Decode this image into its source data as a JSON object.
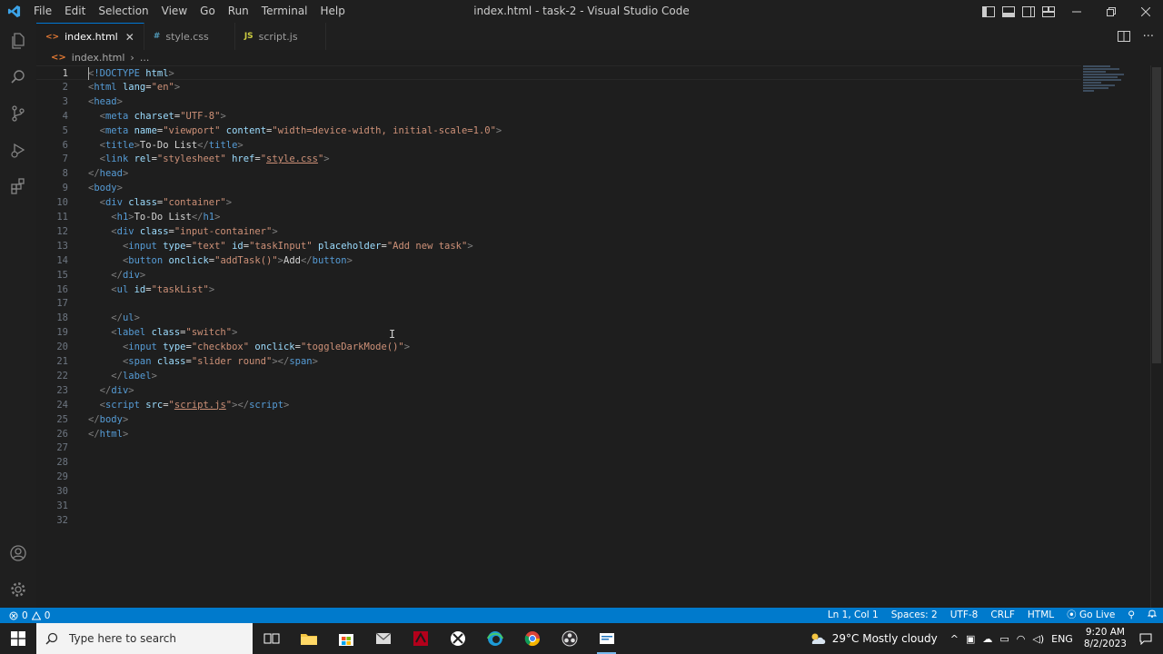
{
  "window": {
    "title": "index.html - task-2 - Visual Studio Code",
    "menu": [
      "File",
      "Edit",
      "Selection",
      "View",
      "Go",
      "Run",
      "Terminal",
      "Help"
    ]
  },
  "tabs": [
    {
      "label": "index.html",
      "type": "html",
      "active": true
    },
    {
      "label": "style.css",
      "type": "css",
      "active": false
    },
    {
      "label": "script.js",
      "type": "js",
      "active": false
    }
  ],
  "tab_icons": {
    "html": "<>",
    "css": "#",
    "js": "JS"
  },
  "breadcrumb": {
    "file": "index.html",
    "more": "..."
  },
  "editor": {
    "current_line": 1,
    "lines": [
      {
        "n": "1",
        "indent": "",
        "tokens": [
          [
            "br",
            "<"
          ],
          [
            "tag",
            "!DOCTYPE"
          ],
          [
            "t",
            " "
          ],
          [
            "attr",
            "html"
          ],
          [
            "br",
            ">"
          ]
        ]
      },
      {
        "n": "2",
        "indent": "",
        "tokens": [
          [
            "br",
            "<"
          ],
          [
            "tag",
            "html"
          ],
          [
            "t",
            " "
          ],
          [
            "attr",
            "lang"
          ],
          [
            "t",
            "="
          ],
          [
            "str",
            "\"en\""
          ],
          [
            "br",
            ">"
          ]
        ]
      },
      {
        "n": "3",
        "indent": "",
        "tokens": [
          [
            "br",
            "<"
          ],
          [
            "tag",
            "head"
          ],
          [
            "br",
            ">"
          ]
        ]
      },
      {
        "n": "4",
        "indent": "  ",
        "tokens": [
          [
            "br",
            "<"
          ],
          [
            "tag",
            "meta"
          ],
          [
            "t",
            " "
          ],
          [
            "attr",
            "charset"
          ],
          [
            "t",
            "="
          ],
          [
            "str",
            "\"UTF-8\""
          ],
          [
            "br",
            ">"
          ]
        ]
      },
      {
        "n": "5",
        "indent": "  ",
        "tokens": [
          [
            "br",
            "<"
          ],
          [
            "tag",
            "meta"
          ],
          [
            "t",
            " "
          ],
          [
            "attr",
            "name"
          ],
          [
            "t",
            "="
          ],
          [
            "str",
            "\"viewport\""
          ],
          [
            "t",
            " "
          ],
          [
            "attr",
            "content"
          ],
          [
            "t",
            "="
          ],
          [
            "str",
            "\"width=device-width, initial-scale=1.0\""
          ],
          [
            "br",
            ">"
          ]
        ]
      },
      {
        "n": "6",
        "indent": "  ",
        "tokens": [
          [
            "br",
            "<"
          ],
          [
            "tag",
            "title"
          ],
          [
            "br",
            ">"
          ],
          [
            "txt",
            "To-Do List"
          ],
          [
            "br",
            "</"
          ],
          [
            "tag",
            "title"
          ],
          [
            "br",
            ">"
          ]
        ]
      },
      {
        "n": "7",
        "indent": "  ",
        "tokens": [
          [
            "br",
            "<"
          ],
          [
            "tag",
            "link"
          ],
          [
            "t",
            " "
          ],
          [
            "attr",
            "rel"
          ],
          [
            "t",
            "="
          ],
          [
            "str",
            "\"stylesheet\""
          ],
          [
            "t",
            " "
          ],
          [
            "attr",
            "href"
          ],
          [
            "t",
            "="
          ],
          [
            "str",
            "\""
          ],
          [
            "link",
            "style.css"
          ],
          [
            "str",
            "\""
          ],
          [
            "br",
            ">"
          ]
        ]
      },
      {
        "n": "8",
        "indent": "",
        "tokens": [
          [
            "br",
            "</"
          ],
          [
            "tag",
            "head"
          ],
          [
            "br",
            ">"
          ]
        ]
      },
      {
        "n": "9",
        "indent": "",
        "tokens": [
          [
            "br",
            "<"
          ],
          [
            "tag",
            "body"
          ],
          [
            "br",
            ">"
          ]
        ]
      },
      {
        "n": "10",
        "indent": "  ",
        "tokens": [
          [
            "br",
            "<"
          ],
          [
            "tag",
            "div"
          ],
          [
            "t",
            " "
          ],
          [
            "attr",
            "class"
          ],
          [
            "t",
            "="
          ],
          [
            "str",
            "\"container\""
          ],
          [
            "br",
            ">"
          ]
        ]
      },
      {
        "n": "11",
        "indent": "    ",
        "tokens": [
          [
            "br",
            "<"
          ],
          [
            "tag",
            "h1"
          ],
          [
            "br",
            ">"
          ],
          [
            "txt",
            "To-Do List"
          ],
          [
            "br",
            "</"
          ],
          [
            "tag",
            "h1"
          ],
          [
            "br",
            ">"
          ]
        ]
      },
      {
        "n": "12",
        "indent": "    ",
        "tokens": [
          [
            "br",
            "<"
          ],
          [
            "tag",
            "div"
          ],
          [
            "t",
            " "
          ],
          [
            "attr",
            "class"
          ],
          [
            "t",
            "="
          ],
          [
            "str",
            "\"input-container\""
          ],
          [
            "br",
            ">"
          ]
        ]
      },
      {
        "n": "13",
        "indent": "      ",
        "tokens": [
          [
            "br",
            "<"
          ],
          [
            "tag",
            "input"
          ],
          [
            "t",
            " "
          ],
          [
            "attr",
            "type"
          ],
          [
            "t",
            "="
          ],
          [
            "str",
            "\"text\""
          ],
          [
            "t",
            " "
          ],
          [
            "attr",
            "id"
          ],
          [
            "t",
            "="
          ],
          [
            "str",
            "\"taskInput\""
          ],
          [
            "t",
            " "
          ],
          [
            "attr",
            "placeholder"
          ],
          [
            "t",
            "="
          ],
          [
            "str",
            "\"Add new task\""
          ],
          [
            "br",
            ">"
          ]
        ]
      },
      {
        "n": "14",
        "indent": "      ",
        "tokens": [
          [
            "br",
            "<"
          ],
          [
            "tag",
            "button"
          ],
          [
            "t",
            " "
          ],
          [
            "attr",
            "onclick"
          ],
          [
            "t",
            "="
          ],
          [
            "str",
            "\"addTask()\""
          ],
          [
            "br",
            ">"
          ],
          [
            "txt",
            "Add"
          ],
          [
            "br",
            "</"
          ],
          [
            "tag",
            "button"
          ],
          [
            "br",
            ">"
          ]
        ]
      },
      {
        "n": "15",
        "indent": "    ",
        "tokens": [
          [
            "br",
            "</"
          ],
          [
            "tag",
            "div"
          ],
          [
            "br",
            ">"
          ]
        ]
      },
      {
        "n": "16",
        "indent": "    ",
        "tokens": [
          [
            "br",
            "<"
          ],
          [
            "tag",
            "ul"
          ],
          [
            "t",
            " "
          ],
          [
            "attr",
            "id"
          ],
          [
            "t",
            "="
          ],
          [
            "str",
            "\"taskList\""
          ],
          [
            "br",
            ">"
          ]
        ]
      },
      {
        "n": "17",
        "indent": "",
        "tokens": []
      },
      {
        "n": "18",
        "indent": "    ",
        "tokens": [
          [
            "br",
            "</"
          ],
          [
            "tag",
            "ul"
          ],
          [
            "br",
            ">"
          ]
        ]
      },
      {
        "n": "19",
        "indent": "    ",
        "tokens": [
          [
            "br",
            "<"
          ],
          [
            "tag",
            "label"
          ],
          [
            "t",
            " "
          ],
          [
            "attr",
            "class"
          ],
          [
            "t",
            "="
          ],
          [
            "str",
            "\"switch\""
          ],
          [
            "br",
            ">"
          ]
        ]
      },
      {
        "n": "20",
        "indent": "      ",
        "tokens": [
          [
            "br",
            "<"
          ],
          [
            "tag",
            "input"
          ],
          [
            "t",
            " "
          ],
          [
            "attr",
            "type"
          ],
          [
            "t",
            "="
          ],
          [
            "str",
            "\"checkbox\""
          ],
          [
            "t",
            " "
          ],
          [
            "attr",
            "onclick"
          ],
          [
            "t",
            "="
          ],
          [
            "str",
            "\"toggleDarkMode()\""
          ],
          [
            "br",
            ">"
          ]
        ]
      },
      {
        "n": "21",
        "indent": "      ",
        "tokens": [
          [
            "br",
            "<"
          ],
          [
            "tag",
            "span"
          ],
          [
            "t",
            " "
          ],
          [
            "attr",
            "class"
          ],
          [
            "t",
            "="
          ],
          [
            "str",
            "\"slider round\""
          ],
          [
            "br",
            ">"
          ],
          [
            "br",
            "</"
          ],
          [
            "tag",
            "span"
          ],
          [
            "br",
            ">"
          ]
        ]
      },
      {
        "n": "22",
        "indent": "    ",
        "tokens": [
          [
            "br",
            "</"
          ],
          [
            "tag",
            "label"
          ],
          [
            "br",
            ">"
          ]
        ]
      },
      {
        "n": "23",
        "indent": "  ",
        "tokens": [
          [
            "br",
            "</"
          ],
          [
            "tag",
            "div"
          ],
          [
            "br",
            ">"
          ]
        ]
      },
      {
        "n": "24",
        "indent": "  ",
        "tokens": [
          [
            "br",
            "<"
          ],
          [
            "tag",
            "script"
          ],
          [
            "t",
            " "
          ],
          [
            "attr",
            "src"
          ],
          [
            "t",
            "="
          ],
          [
            "str",
            "\""
          ],
          [
            "link",
            "script.js"
          ],
          [
            "str",
            "\""
          ],
          [
            "br",
            ">"
          ],
          [
            "br",
            "</"
          ],
          [
            "tag",
            "script"
          ],
          [
            "br",
            ">"
          ]
        ]
      },
      {
        "n": "25",
        "indent": "",
        "tokens": [
          [
            "br",
            "</"
          ],
          [
            "tag",
            "body"
          ],
          [
            "br",
            ">"
          ]
        ]
      },
      {
        "n": "26",
        "indent": "",
        "tokens": [
          [
            "br",
            "</"
          ],
          [
            "tag",
            "html"
          ],
          [
            "br",
            ">"
          ]
        ]
      },
      {
        "n": "27",
        "indent": "",
        "tokens": []
      },
      {
        "n": "28",
        "indent": "",
        "tokens": []
      },
      {
        "n": "29",
        "indent": "",
        "tokens": []
      },
      {
        "n": "30",
        "indent": "",
        "tokens": []
      },
      {
        "n": "31",
        "indent": "",
        "tokens": []
      },
      {
        "n": "32",
        "indent": "",
        "tokens": []
      }
    ]
  },
  "statusbar": {
    "errors": "0",
    "warnings": "0",
    "position": "Ln 1, Col 1",
    "spaces": "Spaces: 2",
    "encoding": "UTF-8",
    "eol": "CRLF",
    "language": "HTML",
    "go_live": "Go Live"
  },
  "taskbar": {
    "search_placeholder": "Type here to search",
    "weather": "29°C  Mostly cloudy",
    "lang": "ENG",
    "time": "9:20 AM",
    "date": "8/2/2023"
  },
  "colors": {
    "accent": "#007acc",
    "tag": "#569cd6",
    "attribute": "#9cdcfe",
    "string": "#ce9178"
  }
}
